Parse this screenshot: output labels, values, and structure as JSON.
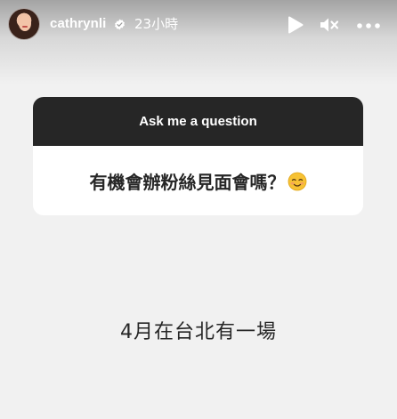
{
  "header": {
    "username": "cathrynli",
    "timestamp": "23小時"
  },
  "icons": {
    "verified": "verified-badge-icon",
    "play": "play-icon",
    "mute": "muted-speaker-icon",
    "more": "more-options-icon",
    "emoji": "smiling-face-emoji-icon"
  },
  "question_card": {
    "header_label": "Ask me a question",
    "question": "有機會辦粉絲見面會嗎？"
  },
  "answer": "4月在台北有一場",
  "colors": {
    "background": "#f1f1f1",
    "card_header": "#262626",
    "card_body": "#ffffff",
    "text_dark": "#262626",
    "text_light": "#ffffff"
  }
}
